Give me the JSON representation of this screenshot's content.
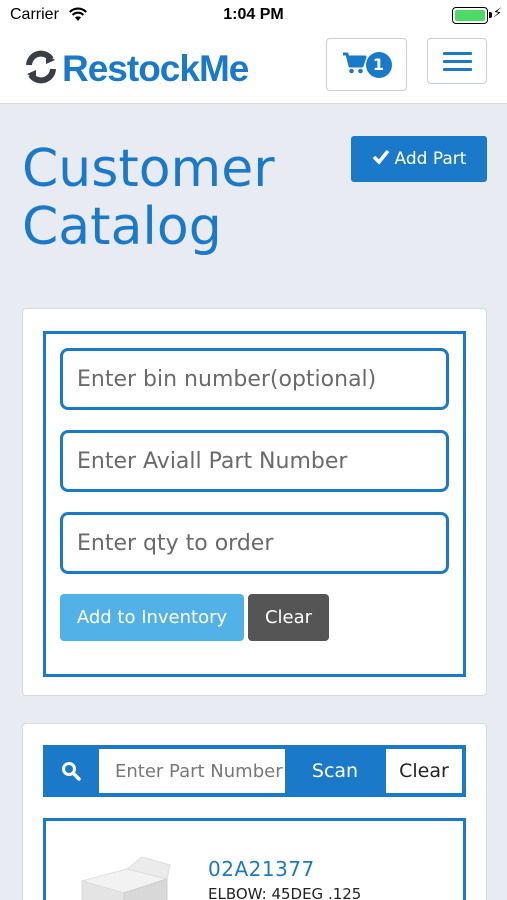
{
  "status_bar": {
    "carrier": "Carrier",
    "time": "1:04 PM"
  },
  "header": {
    "logo_text": "RestockMe",
    "cart_count": "1"
  },
  "page": {
    "title": "Customer Catalog",
    "add_part_label": "Add Part"
  },
  "inventory_form": {
    "bin_placeholder": "Enter bin number(optional)",
    "part_placeholder": "Enter Aviall Part Number",
    "qty_placeholder": "Enter qty to order",
    "add_button_label": "Add to Inventory",
    "clear_button_label": "Clear"
  },
  "search": {
    "placeholder": "Enter Part Number",
    "scan_label": "Scan",
    "clear_label": "Clear"
  },
  "results": [
    {
      "part_number": "02A21377",
      "description": "ELBOW: 45DEG .125"
    }
  ],
  "colors": {
    "accent": "#1a7ac9",
    "add_inventory": "#52b1e6",
    "clear_button": "#555555",
    "background": "#e8ebf1"
  }
}
